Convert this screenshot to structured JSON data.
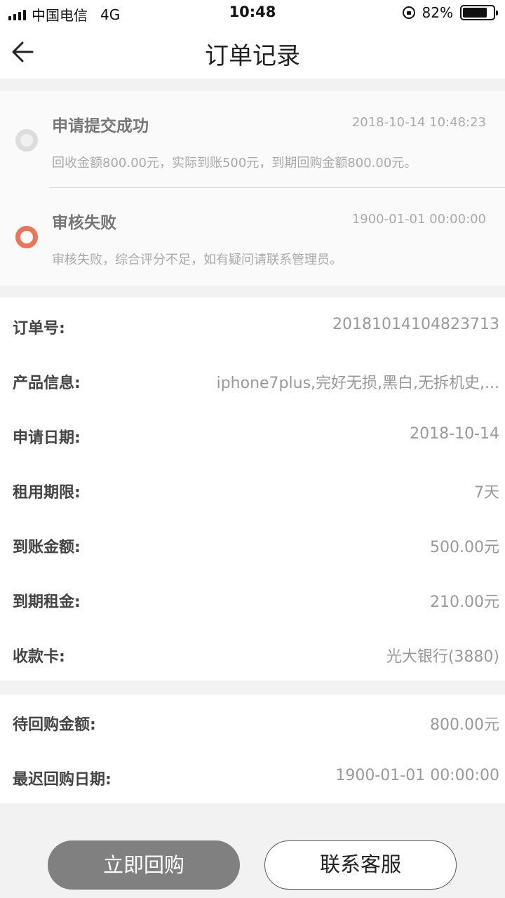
{
  "status_bar": {
    "carrier": "中国电信",
    "network": "4G",
    "time": "10:48",
    "battery": "82%",
    "battery_level": 0.82
  },
  "nav": {
    "title": "订单记录",
    "back_icon": "arrow-left-icon"
  },
  "timeline": [
    {
      "title": "申请提交成功",
      "time": "2018-10-14 10:48:23",
      "desc": "回收金额800.00元，实际到账500元，到期回购金额800.00元。",
      "status": "done",
      "dot_color": "#dddddd"
    },
    {
      "title": "审核失败",
      "time": "1900-01-01 00:00:00",
      "desc": "审核失败，综合评分不足，如有疑问请联系管理员。",
      "status": "current",
      "dot_color": "#ee7457"
    }
  ],
  "order_info": [
    {
      "label": "订单号:",
      "value": "20181014104823713"
    },
    {
      "label": "产品信息:",
      "value": "iphone7plus,完好无损,黑白,无拆机史,..."
    },
    {
      "label": "申请日期:",
      "value": "2018-10-14"
    },
    {
      "label": "租用期限:",
      "value": "7天"
    },
    {
      "label": "到账金额:",
      "value": "500.00元"
    },
    {
      "label": "到期租金:",
      "value": "210.00元"
    },
    {
      "label": "收款卡:",
      "value": "光大银行(3880)"
    }
  ],
  "repay_info": [
    {
      "label": "待回购金额:",
      "value": "800.00元"
    },
    {
      "label": "最迟回购日期:",
      "value": "1900-01-01 00:00:00"
    }
  ],
  "buttons": {
    "buyback": "立即回购",
    "contact": "联系客服"
  }
}
